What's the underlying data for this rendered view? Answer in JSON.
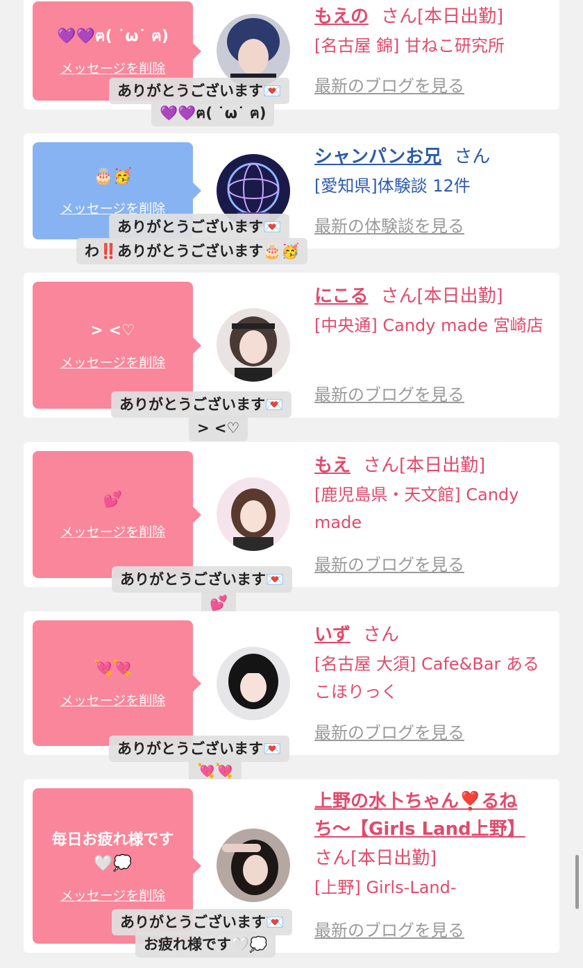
{
  "delete_label": "メッセージを削除",
  "colors": {
    "bubble_pink": "#f9869a",
    "bubble_blue": "#88b3f2",
    "accent_pink": "#e2496b",
    "accent_blue": "#2c5aa8"
  },
  "items": [
    {
      "message": "💜💜ฅ( ˙ω˙ ฅ)",
      "name": "もえの",
      "honorific": "さん[本日出勤]",
      "shop": "[名古屋 錦] 甘ねこ研究所",
      "more": "最新のブログを見る",
      "reply_line1": "ありがとうございます💌",
      "reply_line2": "💜💜ฅ( ˙ω˙ ฅ)"
    },
    {
      "message": "🎂🥳",
      "name": "シャンパンお兄",
      "honorific": "さん",
      "shop": "[愛知県]体験談 12件",
      "more": "最新の体験談を見る",
      "reply_line1": "ありがとうございます💌",
      "reply_line2": "わ‼️ありがとうございます🎂🥳"
    },
    {
      "message": "> <♡",
      "name": "にこる",
      "honorific": "さん[本日出勤]",
      "shop": "[中央通] Candy made 宮崎店",
      "more": "最新のブログを見る",
      "reply_line1": "ありがとうございます💌",
      "reply_line2": "> <♡"
    },
    {
      "message": "💕",
      "name": "もえ",
      "honorific": "さん[本日出勤]",
      "shop": "[鹿児島県・天文館] Candy made",
      "more": "最新のブログを見る",
      "reply_line1": "ありがとうございます💌",
      "reply_line2": "💕"
    },
    {
      "message": "💘💘",
      "name": "いず",
      "honorific": "さん",
      "shop": "[名古屋 大須] Cafe&Bar あるこほりっく",
      "more": "最新のブログを見る",
      "reply_line1": "ありがとうございます💌",
      "reply_line2": "💘💘"
    },
    {
      "message": "毎日お疲れ様です🤍💭",
      "name": "上野の水卜ちゃん❣️るねち〜【Girls Land上野】",
      "honorific": "さん[本日出勤]",
      "shop": "[上野] Girls-Land-",
      "more": "最新のブログを見る",
      "reply_line1": "ありがとうございます💌",
      "reply_line2": "お疲れ様です🤍💭"
    }
  ]
}
